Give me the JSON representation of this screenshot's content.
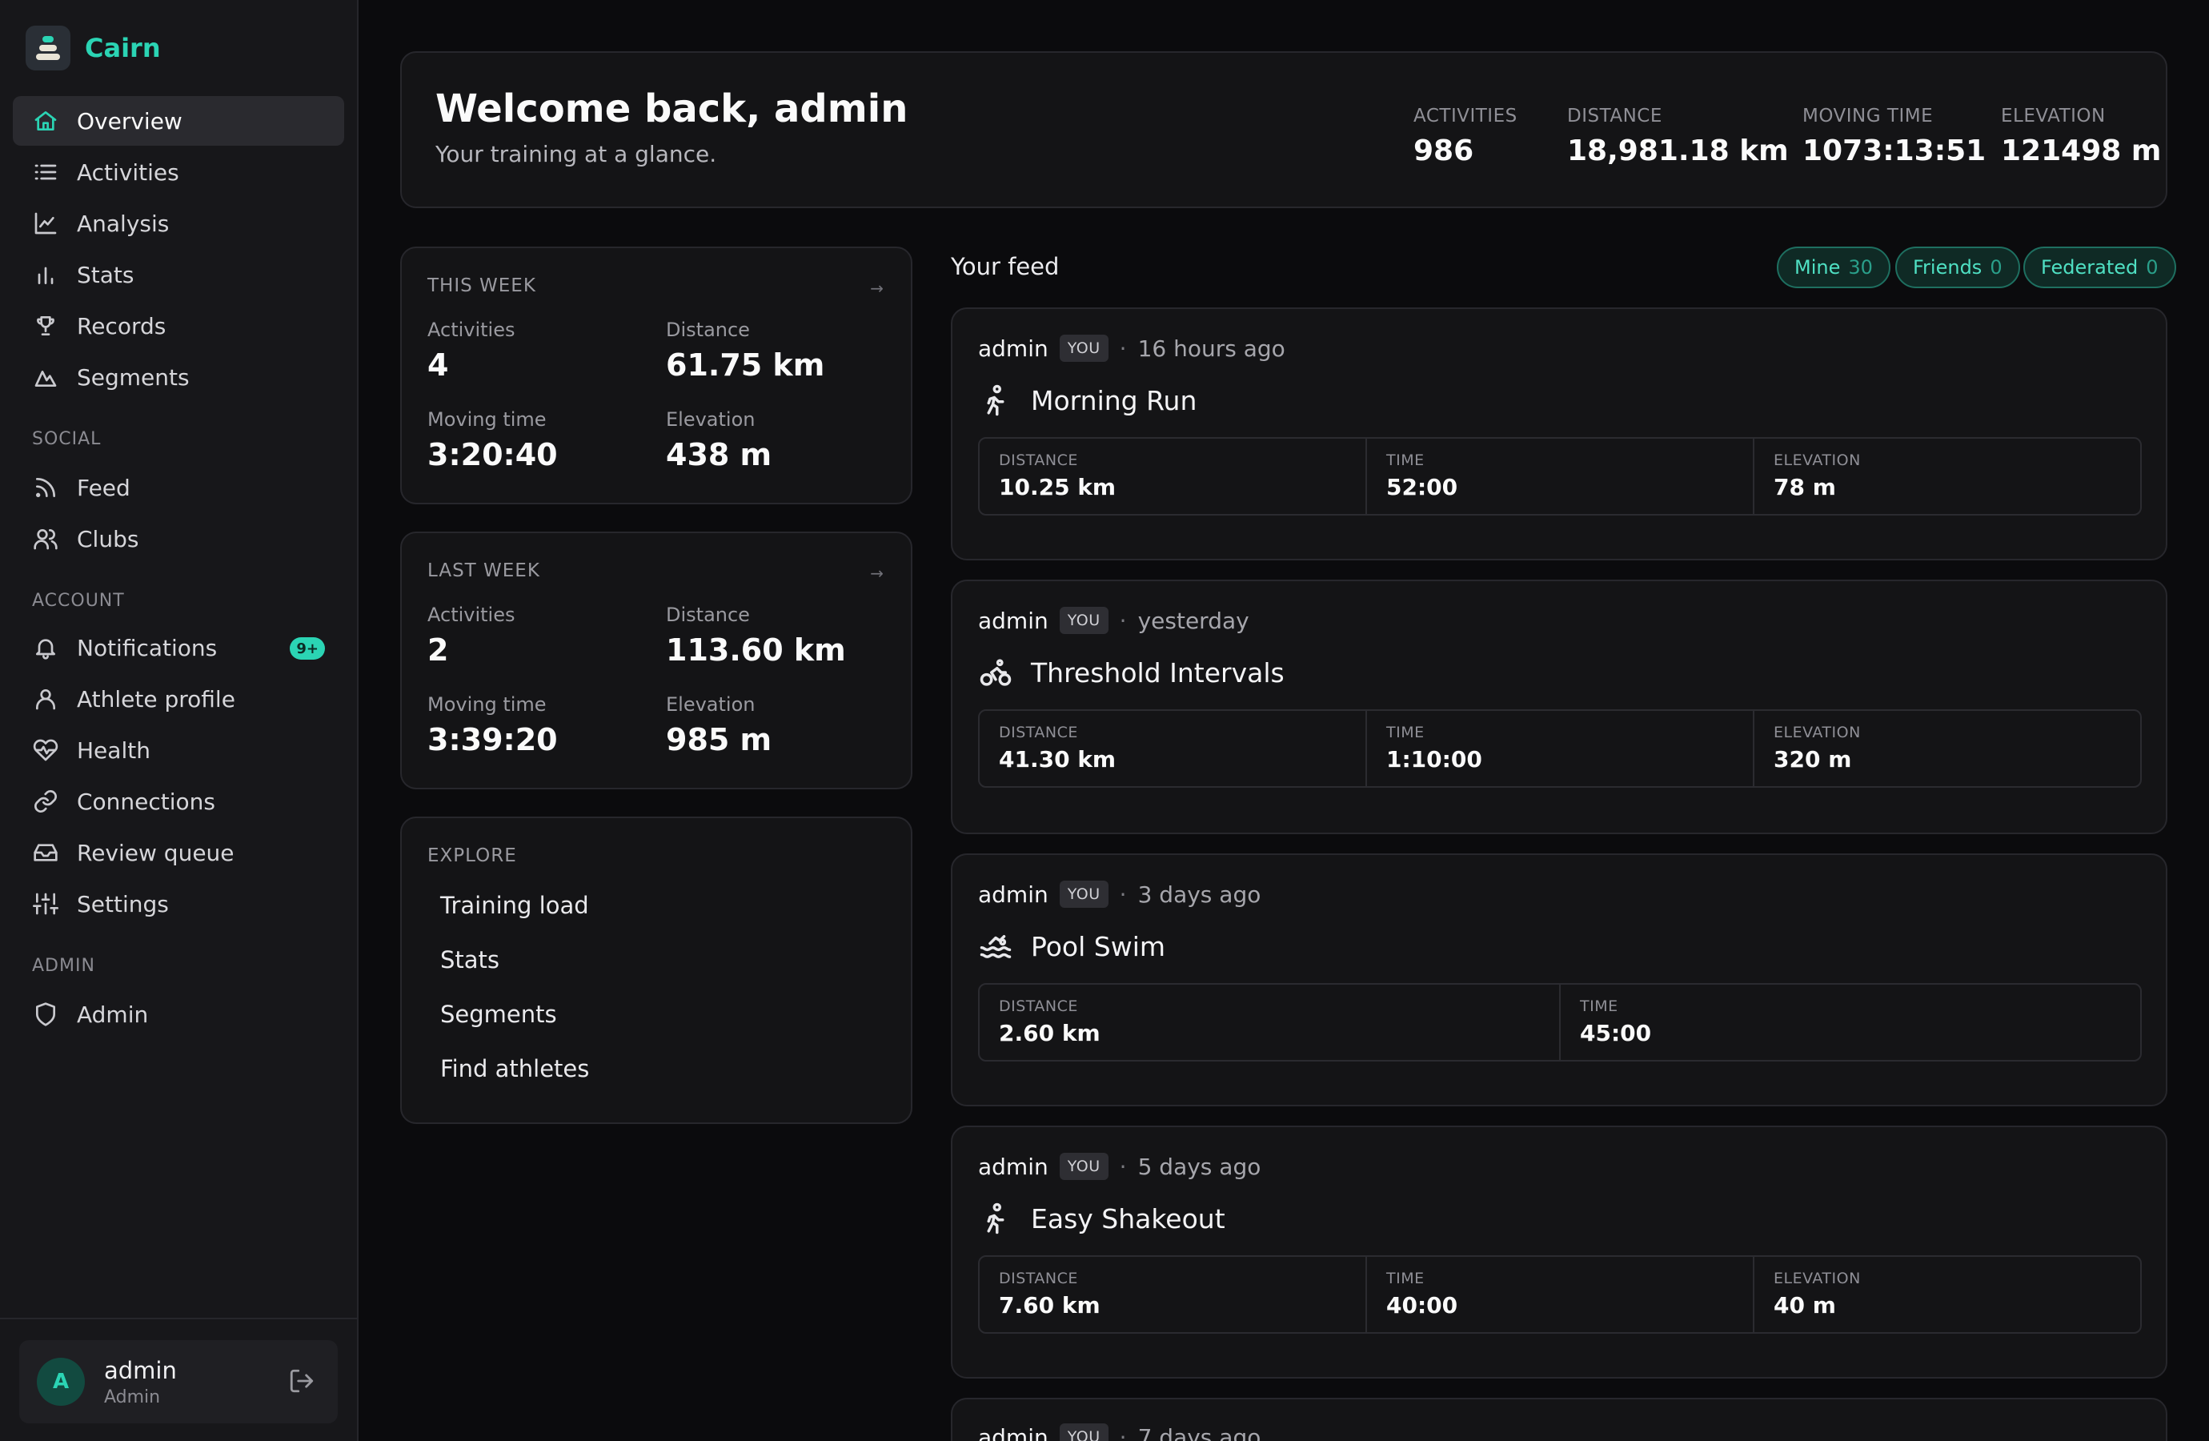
{
  "brand": {
    "name": "Cairn"
  },
  "sidebar": {
    "main": [
      {
        "label": "Overview",
        "icon": "home-icon",
        "active": true
      },
      {
        "label": "Activities",
        "icon": "list-icon"
      },
      {
        "label": "Analysis",
        "icon": "line-chart-icon"
      },
      {
        "label": "Stats",
        "icon": "bar-chart-icon"
      },
      {
        "label": "Records",
        "icon": "trophy-icon"
      },
      {
        "label": "Segments",
        "icon": "mountain-icon"
      }
    ],
    "social_heading": "SOCIAL",
    "social": [
      {
        "label": "Feed",
        "icon": "rss-icon"
      },
      {
        "label": "Clubs",
        "icon": "users-icon"
      }
    ],
    "account_heading": "ACCOUNT",
    "account": [
      {
        "label": "Notifications",
        "icon": "bell-icon",
        "badge": "9+"
      },
      {
        "label": "Athlete profile",
        "icon": "user-icon"
      },
      {
        "label": "Health",
        "icon": "heart-pulse-icon"
      },
      {
        "label": "Connections",
        "icon": "link-icon"
      },
      {
        "label": "Review queue",
        "icon": "inbox-icon"
      },
      {
        "label": "Settings",
        "icon": "sliders-icon"
      }
    ],
    "admin_heading": "ADMIN",
    "admin": [
      {
        "label": "Admin",
        "icon": "shield-icon"
      }
    ]
  },
  "user": {
    "initial": "A",
    "name": "admin",
    "role": "Admin"
  },
  "welcome": {
    "title": "Welcome back, admin",
    "subtitle": "Your training at a glance.",
    "kpis": [
      {
        "label": "ACTIVITIES",
        "value": "986"
      },
      {
        "label": "DISTANCE",
        "value": "18,981.18 km"
      },
      {
        "label": "MOVING TIME",
        "value": "1073:13:51"
      },
      {
        "label": "ELEVATION",
        "value": "121498 m"
      }
    ]
  },
  "this_week": {
    "heading": "THIS WEEK",
    "arrow": "→",
    "activities_label": "Activities",
    "activities": "4",
    "distance_label": "Distance",
    "distance": "61.75 km",
    "moving_label": "Moving time",
    "moving": "3:20:40",
    "elevation_label": "Elevation",
    "elevation": "438 m"
  },
  "last_week": {
    "heading": "LAST WEEK",
    "arrow": "→",
    "activities_label": "Activities",
    "activities": "2",
    "distance_label": "Distance",
    "distance": "113.60 km",
    "moving_label": "Moving time",
    "moving": "3:39:20",
    "elevation_label": "Elevation",
    "elevation": "985 m"
  },
  "explore": {
    "heading": "EXPLORE",
    "links": [
      "Training load",
      "Stats",
      "Segments",
      "Find athletes"
    ]
  },
  "feed": {
    "title": "Your feed",
    "filters": [
      {
        "label": "Mine",
        "count": "30"
      },
      {
        "label": "Friends",
        "count": "0"
      },
      {
        "label": "Federated",
        "count": "0"
      }
    ],
    "posts": [
      {
        "who": "admin",
        "you": "YOU",
        "sep": "·",
        "when": "16 hours ago",
        "icon": "running-icon",
        "title": "Morning Run",
        "metrics": [
          {
            "label": "DISTANCE",
            "value": "10.25 km"
          },
          {
            "label": "TIME",
            "value": "52:00"
          },
          {
            "label": "ELEVATION",
            "value": "78 m"
          }
        ]
      },
      {
        "who": "admin",
        "you": "YOU",
        "sep": "·",
        "when": "yesterday",
        "icon": "bike-icon",
        "title": "Threshold Intervals",
        "metrics": [
          {
            "label": "DISTANCE",
            "value": "41.30 km"
          },
          {
            "label": "TIME",
            "value": "1:10:00"
          },
          {
            "label": "ELEVATION",
            "value": "320 m"
          }
        ]
      },
      {
        "who": "admin",
        "you": "YOU",
        "sep": "·",
        "when": "3 days ago",
        "icon": "swim-icon",
        "title": "Pool Swim",
        "metrics": [
          {
            "label": "DISTANCE",
            "value": "2.60 km"
          },
          {
            "label": "TIME",
            "value": "45:00"
          }
        ]
      },
      {
        "who": "admin",
        "you": "YOU",
        "sep": "·",
        "when": "5 days ago",
        "icon": "running-icon",
        "title": "Easy Shakeout",
        "metrics": [
          {
            "label": "DISTANCE",
            "value": "7.60 km"
          },
          {
            "label": "TIME",
            "value": "40:00"
          },
          {
            "label": "ELEVATION",
            "value": "40 m"
          }
        ]
      },
      {
        "who": "admin",
        "you": "YOU",
        "sep": "·",
        "when": "7 days ago"
      }
    ]
  }
}
